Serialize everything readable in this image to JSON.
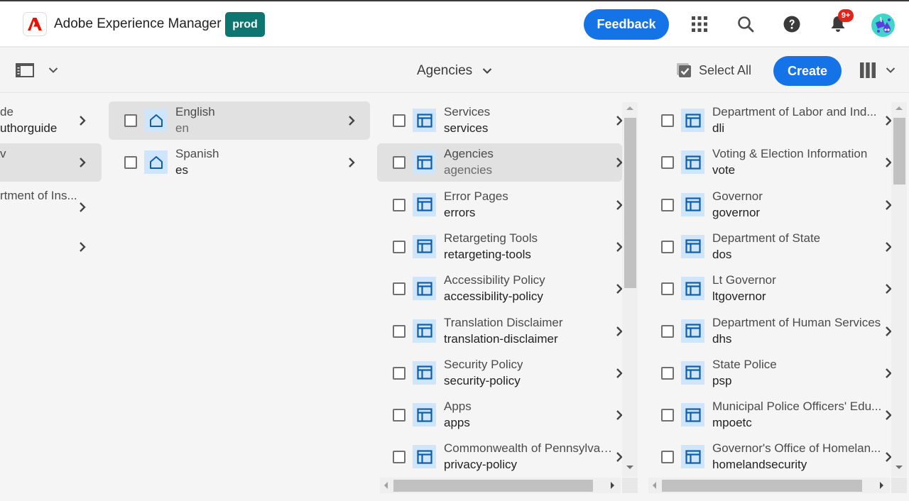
{
  "header": {
    "app_title": "Adobe Experience Manager",
    "env_badge": "prod",
    "feedback_label": "Feedback",
    "notification_count": "9+",
    "icons": [
      "adobe-logo-icon",
      "apps-grid-icon",
      "search-icon",
      "help-icon",
      "bell-icon",
      "user-avatar"
    ]
  },
  "toolbar": {
    "rail_toggle_icon": "side-rail-icon",
    "breadcrumb_label": "Agencies",
    "select_all_label": "Select All",
    "create_label": "Create",
    "view_icon": "column-view-icon"
  },
  "columns": [
    {
      "items": [
        {
          "title": "de",
          "name": "uthorguide",
          "active": false
        },
        {
          "title": "v",
          "name": "",
          "active": true
        },
        {
          "title": "rtment of Ins...",
          "name": "",
          "active": false
        },
        {
          "title": "",
          "name": "",
          "active": false
        }
      ]
    },
    {
      "items": [
        {
          "title": "English",
          "name": "en",
          "active": true,
          "icon": "home-icon"
        },
        {
          "title": "Spanish",
          "name": "es",
          "active": false,
          "icon": "home-icon"
        }
      ]
    },
    {
      "items": [
        {
          "title": "Services",
          "name": "services",
          "active": false,
          "icon": "page-icon"
        },
        {
          "title": "Agencies",
          "name": "agencies",
          "active": true,
          "icon": "page-icon"
        },
        {
          "title": "Error Pages",
          "name": "errors",
          "active": false,
          "icon": "page-icon"
        },
        {
          "title": "Retargeting Tools",
          "name": "retargeting-tools",
          "active": false,
          "icon": "page-icon"
        },
        {
          "title": "Accessibility Policy",
          "name": "accessibility-policy",
          "active": false,
          "icon": "page-icon"
        },
        {
          "title": "Translation Disclaimer",
          "name": "translation-disclaimer",
          "active": false,
          "icon": "page-icon"
        },
        {
          "title": "Security Policy",
          "name": "security-policy",
          "active": false,
          "icon": "page-icon"
        },
        {
          "title": "Apps",
          "name": "apps",
          "active": false,
          "icon": "page-icon"
        },
        {
          "title": "Commonwealth of Pennsylvan...",
          "name": "privacy-policy",
          "active": false,
          "icon": "page-icon"
        }
      ]
    },
    {
      "items": [
        {
          "title": "Department of Labor and Ind...",
          "name": "dli",
          "active": false,
          "icon": "page-icon"
        },
        {
          "title": "Voting & Election Information",
          "name": "vote",
          "active": false,
          "icon": "page-icon"
        },
        {
          "title": "Governor",
          "name": "governor",
          "active": false,
          "icon": "page-icon"
        },
        {
          "title": "Department of State",
          "name": "dos",
          "active": false,
          "icon": "page-icon"
        },
        {
          "title": "Lt Governor",
          "name": "ltgovernor",
          "active": false,
          "icon": "page-icon"
        },
        {
          "title": "Department of Human Services",
          "name": "dhs",
          "active": false,
          "icon": "page-icon"
        },
        {
          "title": "State Police",
          "name": "psp",
          "active": false,
          "icon": "page-icon"
        },
        {
          "title": "Municipal Police Officers' Edu...",
          "name": "mpoetc",
          "active": false,
          "icon": "page-icon"
        },
        {
          "title": "Governor's Office of Homelan...",
          "name": "homelandsecurity",
          "active": false,
          "icon": "page-icon"
        }
      ]
    }
  ],
  "colors": {
    "accent": "#1473e6",
    "env_badge": "#0d7670",
    "notification": "#e1251b",
    "thumb_bg": "#cfe5fb",
    "icon_blue": "#0f5fa8",
    "active_row": "#e1e1e1"
  }
}
